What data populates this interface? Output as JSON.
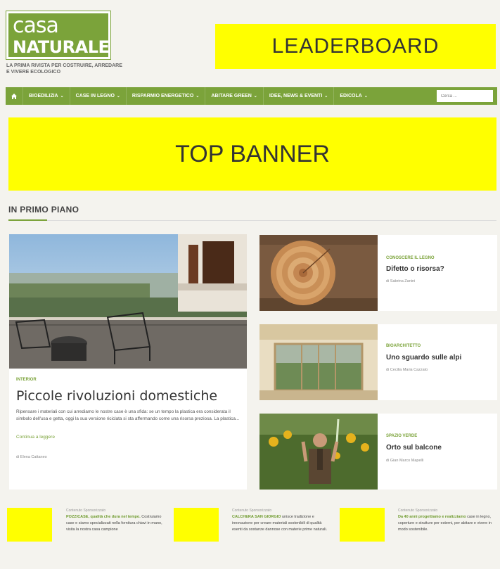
{
  "header": {
    "logo_line1": "casa",
    "logo_line2": "NATURALE",
    "tagline": "LA PRIMA RIVISTA PER COSTRUIRE, ARREDARE E VIVERE ECOLOGICO",
    "leaderboard": "LEADERBOARD"
  },
  "nav": {
    "items": [
      "BIOEDILIZIA",
      "CASE IN LEGNO",
      "RISPARMIO ENERGETICO",
      "ABITARE GREEN",
      "IDEE, NEWS & EVENTI",
      "EDICOLA"
    ],
    "search_placeholder": "Cerca ..."
  },
  "top_banner": "TOP BANNER",
  "section": {
    "title": "IN PRIMO PIANO"
  },
  "main_article": {
    "category": "INTERIOR",
    "title": "Piccole rivoluzioni domestiche",
    "excerpt": "Ripensare i materiali con cui arrediamo le nostre case è una sfida: se un tempo la plastica era considerata il simbolo dell'usa e getta, oggi la sua versione riciclata si sta affermando come una risorsa preziosa. La plastica...",
    "more": "Continua a leggere",
    "author": "di Elena Cattaneo"
  },
  "side_articles": [
    {
      "category": "CONOSCERE IL LEGNO",
      "title": "Difetto o risorsa?",
      "author": "di Sabrina Zanini"
    },
    {
      "category": "BIOARCHITETTO",
      "title": "Uno sguardo sulle alpi",
      "author": "di Cecilia Maria Cazzato"
    },
    {
      "category": "SPAZIO VERDE",
      "title": "Orto sul balcone",
      "author": "di Gian Marco Mapelli"
    }
  ],
  "sponsored": [
    {
      "label": "Contenuto Sponsorizzato",
      "headline": "POZZICASE, qualità che dura nel tempo.",
      "body": "Costruiamo case e siamo specializzati nella fornitura chiavi in mano, visita la nostra casa campione"
    },
    {
      "label": "Contenuto Sponsorizzato",
      "headline": "CALCHERA SAN GIORGIO",
      "body": "unisce tradizione e innovazione per creare materiali sostenibili di qualità esenti da sostanze dannose con materie prime naturali."
    },
    {
      "label": "Contenuto Sponsorizzato",
      "headline": "Da 40 anni progettiamo e realizziamo",
      "body": "case in legno, coperture e strutture per esterni, per abitare e vivere in modo sostenibile."
    }
  ],
  "colors": {
    "brand_green": "#7ba33a",
    "ad_yellow": "#ffff00",
    "page_bg": "#f4f3ee"
  }
}
